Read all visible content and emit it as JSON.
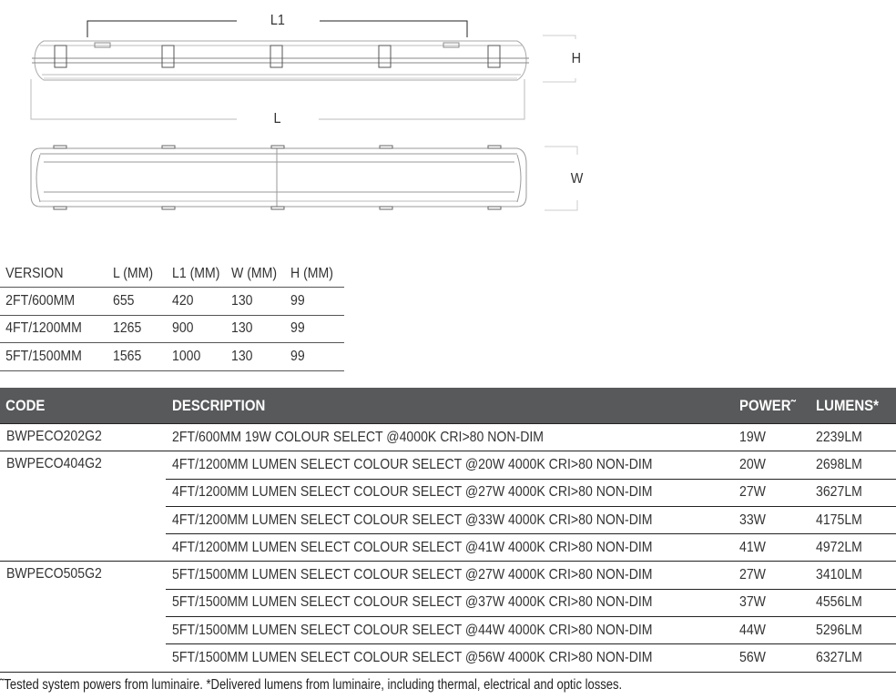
{
  "drawing": {
    "labels": {
      "l1": "L1",
      "l": "L",
      "h": "H",
      "w": "W"
    }
  },
  "dimensions_table": {
    "headers": [
      "VERSION",
      "L (MM)",
      "L1 (MM)",
      "W (MM)",
      "H (MM)"
    ],
    "rows": [
      [
        "2FT/600MM",
        "655",
        "420",
        "130",
        "99"
      ],
      [
        "4FT/1200MM",
        "1265",
        "900",
        "130",
        "99"
      ],
      [
        "5FT/1500MM",
        "1565",
        "1000",
        "130",
        "99"
      ]
    ]
  },
  "product_table": {
    "headers": {
      "code": "CODE",
      "description": "DESCRIPTION",
      "power": "POWER˜",
      "lumens": "LUMENS*"
    },
    "header_bg": "#58595b",
    "groups": [
      {
        "code": "BWPECO202G2",
        "rows": [
          {
            "description": "2FT/600MM 19W COLOUR SELECT @4000K CRI>80 NON-DIM",
            "power": "19W",
            "lumens": "2239LM"
          }
        ]
      },
      {
        "code": "BWPECO404G2",
        "rows": [
          {
            "description": "4FT/1200MM LUMEN SELECT COLOUR SELECT @20W 4000K CRI>80 NON-DIM",
            "power": "20W",
            "lumens": "2698LM"
          },
          {
            "description": "4FT/1200MM LUMEN SELECT COLOUR SELECT @27W 4000K CRI>80 NON-DIM",
            "power": "27W",
            "lumens": "3627LM"
          },
          {
            "description": "4FT/1200MM LUMEN SELECT COLOUR SELECT @33W 4000K CRI>80 NON-DIM",
            "power": "33W",
            "lumens": "4175LM"
          },
          {
            "description": "4FT/1200MM LUMEN SELECT COLOUR SELECT @41W 4000K CRI>80 NON-DIM",
            "power": "41W",
            "lumens": "4972LM"
          }
        ]
      },
      {
        "code": "BWPECO505G2",
        "rows": [
          {
            "description": "5FT/1500MM LUMEN SELECT COLOUR SELECT @27W 4000K CRI>80 NON-DIM",
            "power": "27W",
            "lumens": "3410LM"
          },
          {
            "description": "5FT/1500MM LUMEN SELECT COLOUR SELECT @37W 4000K CRI>80 NON-DIM",
            "power": "37W",
            "lumens": "4556LM"
          },
          {
            "description": "5FT/1500MM LUMEN SELECT COLOUR SELECT @44W 4000K CRI>80 NON-DIM",
            "power": "44W",
            "lumens": "5296LM"
          },
          {
            "description": "5FT/1500MM LUMEN SELECT COLOUR SELECT @56W 4000K CRI>80 NON-DIM",
            "power": "56W",
            "lumens": "6327LM"
          }
        ]
      }
    ]
  },
  "footnote": "˜Tested system powers from luminaire. *Delivered lumens from luminaire, including thermal, electrical and optic losses."
}
